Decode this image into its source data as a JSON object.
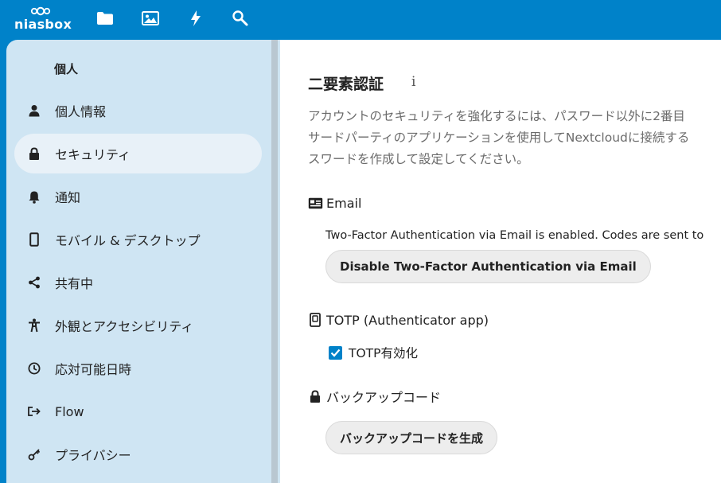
{
  "header": {
    "logo_text": "niasbox",
    "apps": [
      {
        "name": "files",
        "icon": "folder-icon"
      },
      {
        "name": "photos",
        "icon": "image-icon"
      },
      {
        "name": "activity",
        "icon": "lightning-icon"
      },
      {
        "name": "search",
        "icon": "search-icon"
      }
    ]
  },
  "sidebar": {
    "title": "個人",
    "items": [
      {
        "label": "個人情報",
        "icon": "person-icon"
      },
      {
        "label": "セキュリティ",
        "icon": "lock-icon",
        "active": true
      },
      {
        "label": "通知",
        "icon": "bell-icon"
      },
      {
        "label": "モバイル & デスクトップ",
        "icon": "phone-icon"
      },
      {
        "label": "共有中",
        "icon": "share-icon"
      },
      {
        "label": "外観とアクセシビリティ",
        "icon": "accessibility-icon"
      },
      {
        "label": "応対可能日時",
        "icon": "clock-icon"
      },
      {
        "label": "Flow",
        "icon": "flow-icon"
      },
      {
        "label": "プライバシー",
        "icon": "key-icon"
      }
    ]
  },
  "main": {
    "title": "二要素認証",
    "info": "i",
    "description": [
      "アカウントのセキュリティを強化するには、パスワード以外に2番目",
      "サードパーティのアプリケーションを使用してNextcloudに接続する",
      "スワードを作成して設定してください。"
    ],
    "email": {
      "heading": "Email",
      "status": "Two-Factor Authentication via Email is enabled. Codes are sent to",
      "button": "Disable Two-Factor Authentication via Email"
    },
    "totp": {
      "heading": "TOTP (Authenticator app)",
      "checkbox_label": "TOTP有効化",
      "checked": true
    },
    "backup": {
      "heading": "バックアップコード",
      "button": "バックアップコードを生成"
    }
  },
  "colors": {
    "brand": "#0082c9",
    "sidebar_bg": "#cfe5f3",
    "active_item_bg": "#e8f1f8"
  }
}
